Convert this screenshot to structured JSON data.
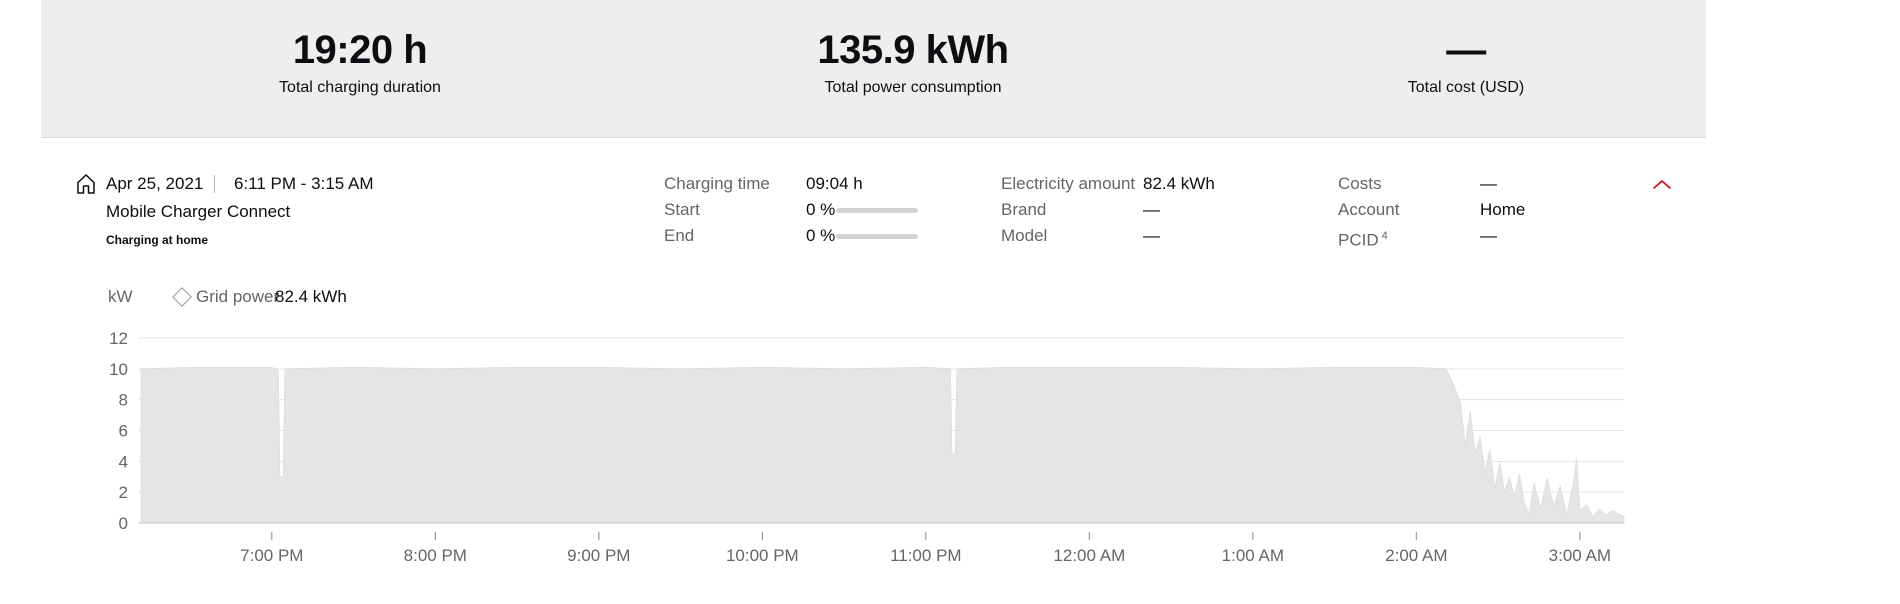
{
  "summary": {
    "duration": {
      "value": "19:20 h",
      "label": "Total charging duration"
    },
    "power": {
      "value": "135.9 kWh",
      "label": "Total power consumption"
    },
    "cost": {
      "value": "—",
      "label": "Total cost (USD)"
    }
  },
  "session": {
    "date": "Apr 25, 2021",
    "time_range": "6:11 PM - 3:15 AM",
    "charger": "Mobile Charger Connect",
    "location": "Charging at home",
    "details": {
      "charging_time": {
        "label": "Charging time",
        "value": "09:04 h"
      },
      "start": {
        "label": "Start",
        "value": "0 %",
        "level": 0
      },
      "end": {
        "label": "End",
        "value": "0 %",
        "level": 0
      },
      "electricity": {
        "label": "Electricity amount",
        "value": "82.4 kWh"
      },
      "brand": {
        "label": "Brand",
        "value": "—"
      },
      "model": {
        "label": "Model",
        "value": "—"
      },
      "costs": {
        "label": "Costs",
        "value": "—"
      },
      "account": {
        "label": "Account",
        "value": "Home"
      },
      "pcid": {
        "label": "PCID",
        "sup": "4",
        "value": "—"
      }
    }
  },
  "colors": {
    "accent": "#d5001c",
    "area_fill": "#e5e5e5",
    "text": "#0e0e12",
    "muted": "#626669",
    "summary_bg": "#eeeeee"
  },
  "icons": {
    "location": "home-icon",
    "expand": "chevron-up-icon",
    "legend": "diamond-icon"
  },
  "chart_data": {
    "type": "area",
    "ylabel": "kW",
    "legend": {
      "name": "Grid power",
      "value": "82.4 kWh"
    },
    "ylim": [
      0,
      12
    ],
    "yticks": [
      "0",
      "2",
      "4",
      "6",
      "8",
      "10",
      "12"
    ],
    "x_range_hours": [
      18.2,
      27.27
    ],
    "xticks": [
      {
        "label": "7:00 PM",
        "hour": 19
      },
      {
        "label": "8:00 PM",
        "hour": 20
      },
      {
        "label": "9:00 PM",
        "hour": 21
      },
      {
        "label": "10:00 PM",
        "hour": 22
      },
      {
        "label": "11:00 PM",
        "hour": 23
      },
      {
        "label": "12:00 AM",
        "hour": 24
      },
      {
        "label": "1:00 AM",
        "hour": 25
      },
      {
        "label": "2:00 AM",
        "hour": 26
      },
      {
        "label": "3:00 AM",
        "hour": 27
      }
    ],
    "grid": true,
    "series": [
      {
        "name": "Grid power",
        "points": [
          [
            18.2,
            10.0
          ],
          [
            18.55,
            10.1
          ],
          [
            19.0,
            10.1
          ],
          [
            19.04,
            9.9
          ],
          [
            19.05,
            3.0
          ],
          [
            19.07,
            3.0
          ],
          [
            19.08,
            10.0
          ],
          [
            19.5,
            10.1
          ],
          [
            20.0,
            10.0
          ],
          [
            20.5,
            10.1
          ],
          [
            21.0,
            10.1
          ],
          [
            21.5,
            10.0
          ],
          [
            22.0,
            10.1
          ],
          [
            22.5,
            10.0
          ],
          [
            23.0,
            10.1
          ],
          [
            23.15,
            10.0
          ],
          [
            23.16,
            4.5
          ],
          [
            23.18,
            4.5
          ],
          [
            23.19,
            10.0
          ],
          [
            23.5,
            10.1
          ],
          [
            24.0,
            10.1
          ],
          [
            24.5,
            10.1
          ],
          [
            25.0,
            10.0
          ],
          [
            25.5,
            10.1
          ],
          [
            26.0,
            10.1
          ],
          [
            26.18,
            10.0
          ],
          [
            26.22,
            9.2
          ],
          [
            26.27,
            7.8
          ],
          [
            26.3,
            5.0
          ],
          [
            26.33,
            7.3
          ],
          [
            26.36,
            4.5
          ],
          [
            26.39,
            5.6
          ],
          [
            26.42,
            3.2
          ],
          [
            26.45,
            4.8
          ],
          [
            26.48,
            2.2
          ],
          [
            26.51,
            3.9
          ],
          [
            26.54,
            2.0
          ],
          [
            26.57,
            3.0
          ],
          [
            26.6,
            1.7
          ],
          [
            26.63,
            3.2
          ],
          [
            26.66,
            1.3
          ],
          [
            26.69,
            0.6
          ],
          [
            26.72,
            2.6
          ],
          [
            26.76,
            0.9
          ],
          [
            26.8,
            2.9
          ],
          [
            26.84,
            1.1
          ],
          [
            26.88,
            2.4
          ],
          [
            26.92,
            0.5
          ],
          [
            26.96,
            2.6
          ],
          [
            26.98,
            4.2
          ],
          [
            27.0,
            0.8
          ],
          [
            27.04,
            1.2
          ],
          [
            27.08,
            0.4
          ],
          [
            27.12,
            0.9
          ],
          [
            27.16,
            0.5
          ],
          [
            27.2,
            0.8
          ],
          [
            27.27,
            0.4
          ]
        ]
      }
    ]
  }
}
